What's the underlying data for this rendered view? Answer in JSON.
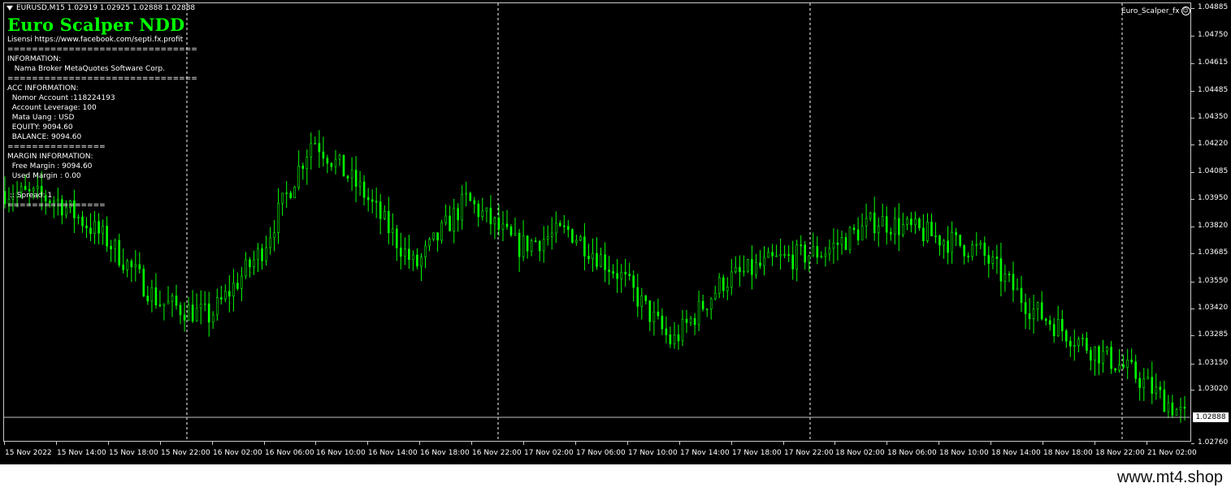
{
  "window": {
    "symbol_line": "EURUSD,M15  1.02919 1.02925 1.02888 1.02888",
    "indicator_label": "Euro_Scalper_fx"
  },
  "ea_panel": {
    "title": "Euro Scalper NDD",
    "lines": [
      "Lisensi https://www.facebook.com/septi.fx.profit",
      "===============================",
      "INFORMATION:",
      "   Nama Broker MetaQuotes Software Corp.",
      "===============================",
      "ACC INFORMATION:",
      "  Nomor Account :118224193",
      "  Account Leverage: 100",
      "  Mata Uang : USD",
      "  EQUITY: 9094.60",
      "  BALANCE: 9094.60",
      "================",
      "MARGIN INFORMATION:",
      "  Free Margin : 9094.60",
      "  Used Margin : 0.00",
      "",
      " :: Spread: 1",
      "================"
    ]
  },
  "price_axis": {
    "ticks": [
      "1.04885",
      "1.04750",
      "1.04615",
      "1.04485",
      "1.04350",
      "1.04220",
      "1.04085",
      "1.03950",
      "1.03820",
      "1.03685",
      "1.03550",
      "1.03420",
      "1.03285",
      "1.03150",
      "1.03020",
      "1.02760"
    ],
    "current_price": "1.02888"
  },
  "time_axis": {
    "ticks": [
      "15 Nov 2022",
      "15 Nov 14:00",
      "15 Nov 18:00",
      "15 Nov 22:00",
      "16 Nov 02:00",
      "16 Nov 06:00",
      "16 Nov 10:00",
      "16 Nov 14:00",
      "16 Nov 18:00",
      "16 Nov 22:00",
      "17 Nov 02:00",
      "17 Nov 06:00",
      "17 Nov 10:00",
      "17 Nov 14:00",
      "17 Nov 18:00",
      "17 Nov 22:00",
      "18 Nov 02:00",
      "18 Nov 06:00",
      "18 Nov 10:00",
      "18 Nov 14:00",
      "18 Nov 18:00",
      "18 Nov 22:00",
      "21 Nov 02:00"
    ]
  },
  "chart_data": {
    "type": "line",
    "title": "EURUSD,M15",
    "price_min": 1.0276,
    "price_max": 1.04885,
    "x": [
      "15 Nov 2022",
      "15 Nov 14:00",
      "15 Nov 18:00",
      "15 Nov 22:00",
      "16 Nov 02:00",
      "16 Nov 06:00",
      "16 Nov 10:00",
      "16 Nov 14:00",
      "16 Nov 18:00",
      "16 Nov 22:00",
      "17 Nov 02:00",
      "17 Nov 06:00",
      "17 Nov 10:00",
      "17 Nov 14:00",
      "17 Nov 18:00",
      "17 Nov 22:00",
      "18 Nov 02:00",
      "18 Nov 06:00",
      "18 Nov 10:00",
      "18 Nov 14:00",
      "18 Nov 18:00",
      "18 Nov 22:00",
      "21 Nov 02:00"
    ],
    "anchors": [
      1.0399,
      1.0395,
      1.0375,
      1.0345,
      1.0338,
      1.037,
      1.0425,
      1.0398,
      1.0362,
      1.0395,
      1.0372,
      1.038,
      1.0358,
      1.0325,
      1.0355,
      1.0365,
      1.037,
      1.0385,
      1.0378,
      1.037,
      1.0342,
      1.0325,
      1.031,
      1.02888
    ],
    "sessions_separators": [
      "15 Nov 22:00",
      "16 Nov 22:00",
      "17 Nov 22:00",
      "18 Nov 22:00"
    ],
    "colors": {
      "bull": "#00ff00",
      "bear": "#00ff00",
      "background": "#000000",
      "grid": "#ffffff"
    }
  }
}
